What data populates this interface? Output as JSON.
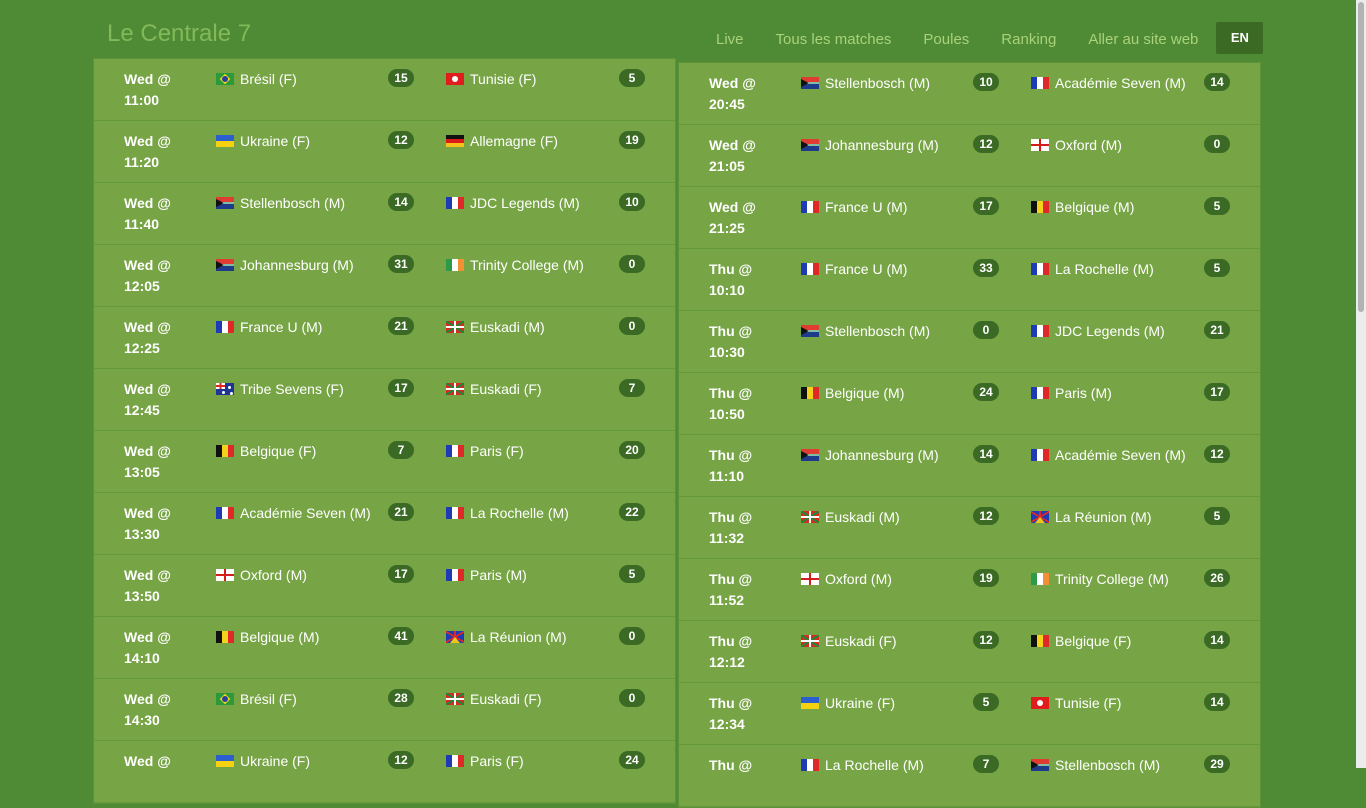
{
  "header": {
    "title": "Le Centrale 7",
    "nav": [
      "Live",
      "Tous les matches",
      "Poules",
      "Ranking",
      "Aller au site web"
    ],
    "lang": "EN"
  },
  "colors": {
    "background": "#4f8a34",
    "panel": "#77a545",
    "badge": "#3b6a24",
    "nav_link": "#a9d27a"
  },
  "left_matches": [
    {
      "day": "Wed @",
      "time": "11:00",
      "home": "Brésil (F)",
      "home_flag": "br",
      "home_score": "15",
      "away": "Tunisie (F)",
      "away_flag": "tn",
      "away_score": "5"
    },
    {
      "day": "Wed @",
      "time": "11:20",
      "home": "Ukraine (F)",
      "home_flag": "ua",
      "home_score": "12",
      "away": "Allemagne (F)",
      "away_flag": "de",
      "away_score": "19"
    },
    {
      "day": "Wed @",
      "time": "11:40",
      "home": "Stellenbosch (M)",
      "home_flag": "za",
      "home_score": "14",
      "away": "JDC Legends (M)",
      "away_flag": "fr",
      "away_score": "10"
    },
    {
      "day": "Wed @",
      "time": "12:05",
      "home": "Johannesburg (M)",
      "home_flag": "za",
      "home_score": "31",
      "away": "Trinity College (M)",
      "away_flag": "ie",
      "away_score": "0"
    },
    {
      "day": "Wed @",
      "time": "12:25",
      "home": "France U (M)",
      "home_flag": "fr",
      "home_score": "21",
      "away": "Euskadi (M)",
      "away_flag": "basque",
      "away_score": "0"
    },
    {
      "day": "Wed @",
      "time": "12:45",
      "home": "Tribe Sevens (F)",
      "home_flag": "au",
      "home_score": "17",
      "away": "Euskadi (F)",
      "away_flag": "basque",
      "away_score": "7"
    },
    {
      "day": "Wed @",
      "time": "13:05",
      "home": "Belgique (F)",
      "home_flag": "be",
      "home_score": "7",
      "away": "Paris (F)",
      "away_flag": "fr",
      "away_score": "20"
    },
    {
      "day": "Wed @",
      "time": "13:30",
      "home": "Académie Seven (M)",
      "home_flag": "fr",
      "home_score": "21",
      "away": "La Rochelle (M)",
      "away_flag": "fr",
      "away_score": "22"
    },
    {
      "day": "Wed @",
      "time": "13:50",
      "home": "Oxford (M)",
      "home_flag": "gb-eng",
      "home_score": "17",
      "away": "Paris (M)",
      "away_flag": "fr",
      "away_score": "5"
    },
    {
      "day": "Wed @",
      "time": "14:10",
      "home": "Belgique (M)",
      "home_flag": "be",
      "home_score": "41",
      "away": "La Réunion (M)",
      "away_flag": "re",
      "away_score": "0"
    },
    {
      "day": "Wed @",
      "time": "14:30",
      "home": "Brésil (F)",
      "home_flag": "br",
      "home_score": "28",
      "away": "Euskadi (F)",
      "away_flag": "basque",
      "away_score": "0"
    },
    {
      "day": "Wed @",
      "time": "",
      "home": "Ukraine (F)",
      "home_flag": "ua",
      "home_score": "12",
      "away": "Paris (F)",
      "away_flag": "fr",
      "away_score": "24"
    }
  ],
  "right_matches": [
    {
      "day": "Wed @",
      "time": "20:45",
      "home": "Stellenbosch (M)",
      "home_flag": "za",
      "home_score": "10",
      "away": "Académie Seven (M)",
      "away_flag": "fr",
      "away_score": "14"
    },
    {
      "day": "Wed @",
      "time": "21:05",
      "home": "Johannesburg (M)",
      "home_flag": "za",
      "home_score": "12",
      "away": "Oxford (M)",
      "away_flag": "gb-eng",
      "away_score": "0"
    },
    {
      "day": "Wed @",
      "time": "21:25",
      "home": "France U (M)",
      "home_flag": "fr",
      "home_score": "17",
      "away": "Belgique (M)",
      "away_flag": "be",
      "away_score": "5"
    },
    {
      "day": "Thu @",
      "time": "10:10",
      "home": "France U (M)",
      "home_flag": "fr",
      "home_score": "33",
      "away": "La Rochelle (M)",
      "away_flag": "fr",
      "away_score": "5"
    },
    {
      "day": "Thu @",
      "time": "10:30",
      "home": "Stellenbosch (M)",
      "home_flag": "za",
      "home_score": "0",
      "away": "JDC Legends (M)",
      "away_flag": "fr",
      "away_score": "21"
    },
    {
      "day": "Thu @",
      "time": "10:50",
      "home": "Belgique (M)",
      "home_flag": "be",
      "home_score": "24",
      "away": "Paris (M)",
      "away_flag": "fr",
      "away_score": "17"
    },
    {
      "day": "Thu @",
      "time": "11:10",
      "home": "Johannesburg (M)",
      "home_flag": "za",
      "home_score": "14",
      "away": "Académie Seven (M)",
      "away_flag": "fr",
      "away_score": "12"
    },
    {
      "day": "Thu @",
      "time": "11:32",
      "home": "Euskadi (M)",
      "home_flag": "basque",
      "home_score": "12",
      "away": "La Réunion (M)",
      "away_flag": "re",
      "away_score": "5"
    },
    {
      "day": "Thu @",
      "time": "11:52",
      "home": "Oxford (M)",
      "home_flag": "gb-eng",
      "home_score": "19",
      "away": "Trinity College (M)",
      "away_flag": "ie",
      "away_score": "26"
    },
    {
      "day": "Thu @",
      "time": "12:12",
      "home": "Euskadi (F)",
      "home_flag": "basque",
      "home_score": "12",
      "away": "Belgique (F)",
      "away_flag": "be",
      "away_score": "14"
    },
    {
      "day": "Thu @",
      "time": "12:34",
      "home": "Ukraine (F)",
      "home_flag": "ua",
      "home_score": "5",
      "away": "Tunisie (F)",
      "away_flag": "tn",
      "away_score": "14"
    },
    {
      "day": "Thu @",
      "time": "",
      "home": "La Rochelle (M)",
      "home_flag": "fr",
      "home_score": "7",
      "away": "Stellenbosch (M)",
      "away_flag": "za",
      "away_score": "29"
    }
  ]
}
